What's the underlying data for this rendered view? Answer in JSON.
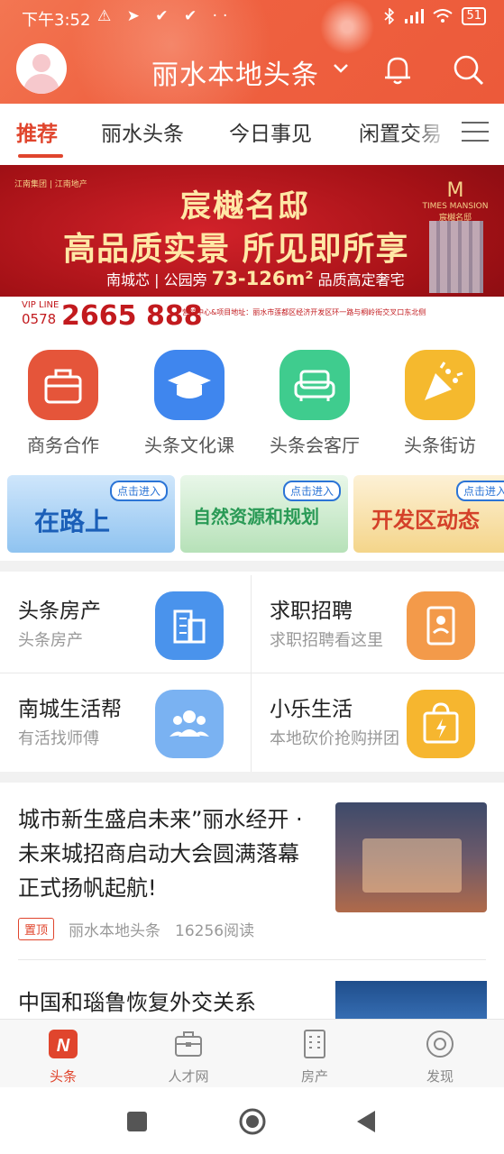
{
  "status": {
    "time": "下午3:52",
    "left_icons": "⚠ ➤ ✔ ✔ ··",
    "battery": "51"
  },
  "header": {
    "title": "丽水本地头条"
  },
  "tabs": [
    {
      "label": "推荐"
    },
    {
      "label": "丽水头条"
    },
    {
      "label": "今日事见"
    },
    {
      "label": "闲置交易"
    }
  ],
  "banner": {
    "brands": "江南集团 | 江南地产",
    "title": "宸樾名邸",
    "subtitle": "高品质实景 所见即所享",
    "line_a": "南城芯 | 公园旁",
    "line_b": "73-126m²",
    "line_c": "品质高定奢宅",
    "tm_en": "TIMES MANSION",
    "tm_cn": "宸樾名邸",
    "vip": "VIP LINE",
    "phone_prefix": "0578",
    "phone": "2665 888",
    "address": "营销中心&项目地址：丽水市莲都区经济开发区环一路与桐岭街交叉口东北侧"
  },
  "quick": [
    {
      "label": "商务合作",
      "icon": "briefcase-icon",
      "color": "#e5553a"
    },
    {
      "label": "头条文化课",
      "icon": "graduation-cap-icon",
      "color": "#3f86ee"
    },
    {
      "label": "头条会客厅",
      "icon": "sofa-icon",
      "color": "#3fcc8e"
    },
    {
      "label": "头条街访",
      "icon": "party-popper-icon",
      "color": "#f5b92e"
    }
  ],
  "minis": [
    {
      "text": "在路上",
      "cta": "点击进入"
    },
    {
      "text": "自然资源和规划",
      "cta": "点击进入"
    },
    {
      "text": "开发区动态",
      "cta": "点击进入"
    }
  ],
  "services": [
    {
      "title": "头条房产",
      "sub": "头条房产",
      "icon": "buildings-icon",
      "color": "#4a93ec"
    },
    {
      "title": "求职招聘",
      "sub": "求职招聘看这里",
      "icon": "resume-icon",
      "color": "#f39a4a"
    },
    {
      "title": "南城生活帮",
      "sub": "有活找师傅",
      "icon": "people-icon",
      "color": "#7ab2f2"
    },
    {
      "title": "小乐生活",
      "sub": "本地砍价抢购拼团",
      "icon": "lightning-bag-icon",
      "color": "#f6b62f"
    }
  ],
  "news": [
    {
      "title": "城市新生盛启未来”丽水经开 · 未来城招商启动大会圆满落幕正式扬帆起航!",
      "tag": "置顶",
      "source": "丽水本地头条",
      "reads": "16256阅读"
    },
    {
      "title": "中国和瑙鲁恢复外交关系"
    }
  ],
  "bottomnav": [
    {
      "label": "头条",
      "icon": "toutiao-logo-icon"
    },
    {
      "label": "人才网",
      "icon": "briefcase-outline-icon"
    },
    {
      "label": "房产",
      "icon": "building-outline-icon"
    },
    {
      "label": "发现",
      "icon": "eye-icon"
    }
  ],
  "colors": {
    "accent": "#e0452d",
    "header": "#ef6140"
  }
}
